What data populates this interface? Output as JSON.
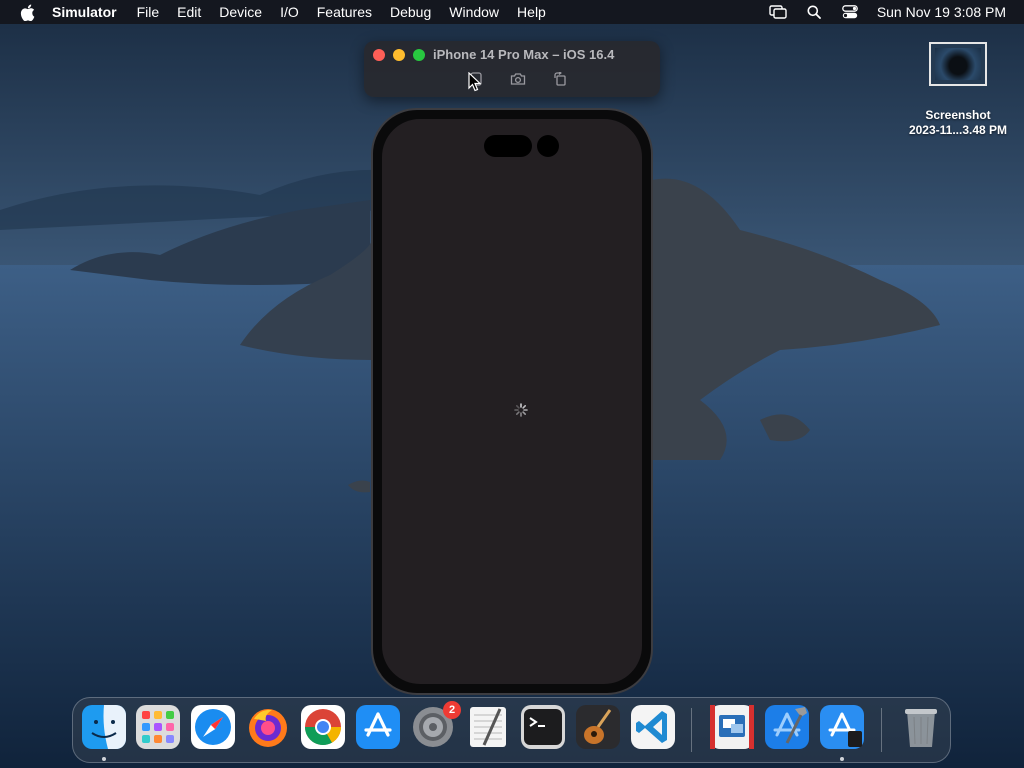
{
  "menubar": {
    "app_name": "Simulator",
    "items": [
      "File",
      "Edit",
      "Device",
      "I/O",
      "Features",
      "Debug",
      "Window",
      "Help"
    ],
    "clock": "Sun Nov 19  3:08 PM",
    "status_icons": [
      "screen-mirroring-icon",
      "search-icon",
      "control-center-icon"
    ]
  },
  "desktop": {
    "file_name_line1": "Screenshot",
    "file_name_line2": "2023-11...3.48 PM"
  },
  "simulator": {
    "title": "iPhone 14 Pro Max – iOS 16.4",
    "tools": [
      "home-icon",
      "screenshot-icon",
      "rotate-icon"
    ],
    "screen_state": "loading",
    "screen_color": "#231f22"
  },
  "dock": {
    "apps": [
      {
        "name": "Finder",
        "icon": "finder-icon",
        "running": true
      },
      {
        "name": "Launchpad",
        "icon": "launchpad-icon",
        "running": false
      },
      {
        "name": "Safari",
        "icon": "safari-icon",
        "running": false
      },
      {
        "name": "Firefox",
        "icon": "firefox-icon",
        "running": false
      },
      {
        "name": "Google Chrome",
        "icon": "chrome-icon",
        "running": false
      },
      {
        "name": "App Store",
        "icon": "app-store-icon",
        "running": false
      },
      {
        "name": "System Settings",
        "icon": "system-settings-icon",
        "running": false,
        "badge": "2"
      },
      {
        "name": "TextEdit",
        "icon": "textedit-icon",
        "running": false
      },
      {
        "name": "Terminal",
        "icon": "terminal-icon",
        "running": false
      },
      {
        "name": "GarageBand",
        "icon": "garageband-icon",
        "running": false
      },
      {
        "name": "Visual Studio Code",
        "icon": "vscode-icon",
        "running": false
      },
      {
        "name": "Parallels",
        "icon": "parallels-icon",
        "running": false
      },
      {
        "name": "Xcode",
        "icon": "xcode-icon",
        "running": false
      },
      {
        "name": "Simulator",
        "icon": "simulator-icon",
        "running": true
      },
      {
        "name": "Trash",
        "icon": "trash-icon",
        "running": false
      }
    ]
  },
  "colors": {
    "accent_red": "#fe5f57",
    "accent_yellow": "#febc2e",
    "accent_green": "#28c840",
    "badge_red": "#ee3b34"
  }
}
